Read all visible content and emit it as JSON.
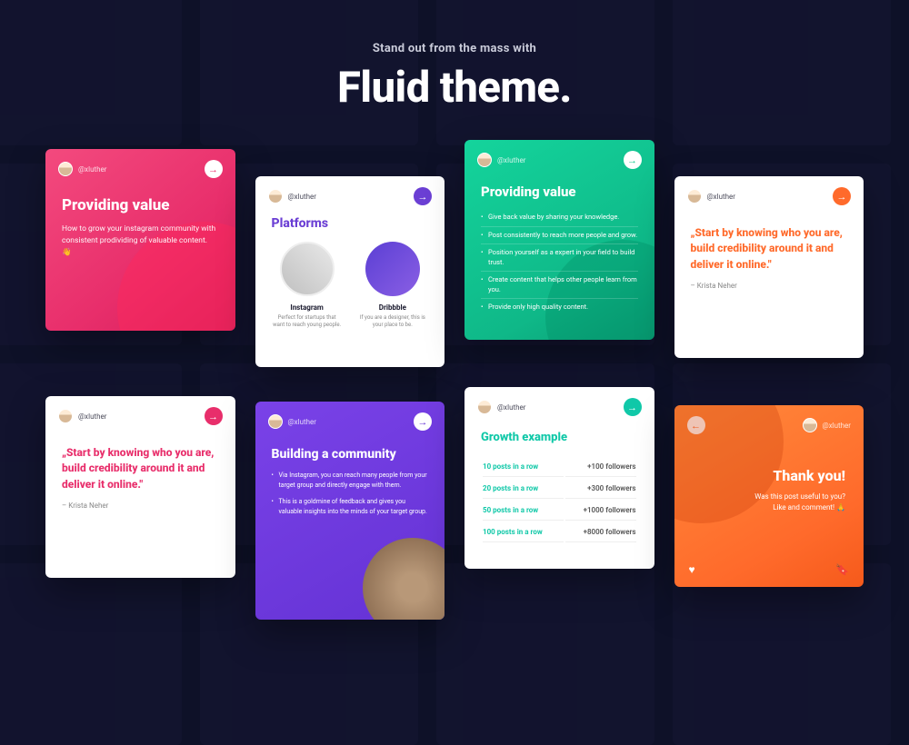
{
  "header": {
    "subtitle": "Stand out from the mass with",
    "title": "Fluid theme."
  },
  "handle": "@xluther",
  "cards": {
    "c1": {
      "title": "Providing value",
      "body": "How to grow your instagram community with consistent prodividing of valuable content. 👋"
    },
    "c2": {
      "title": "Platforms",
      "platforms": [
        {
          "name": "Instagram",
          "desc": "Perfect for startups that want to reach young people."
        },
        {
          "name": "Dribbble",
          "desc": "If you are a designer, this is your place to be."
        }
      ]
    },
    "c3": {
      "title": "Providing value",
      "items": [
        "Give back value by sharing your knowledge.",
        "Post consistently to reach more people and grow.",
        "Position yourself as a expert in your field to build trust.",
        "Create content that helps other people learn from you.",
        "Provide only high quality content."
      ]
    },
    "c4": {
      "quote": "„Start by knowing who you are, build credibility around it and deliver it online.\"",
      "author": "– Krista Neher"
    },
    "c5": {
      "quote": "„Start by knowing who you are, build credibility around it and deliver it online.\"",
      "author": "– Krista Neher"
    },
    "c6": {
      "title": "Building a community",
      "items": [
        "Via Instagram, you can reach many people from your target group and directly engage with them.",
        "This is a goldmine of feedback and gives you valuable insights into the minds of your target group."
      ]
    },
    "c7": {
      "title": "Growth example",
      "rows": [
        {
          "left": "10 posts in a row",
          "right": "+100 followers"
        },
        {
          "left": "20 posts in a row",
          "right": "+300 followers"
        },
        {
          "left": "50 posts in a row",
          "right": "+1000 followers"
        },
        {
          "left": "100 posts in a row",
          "right": "+8000 followers"
        }
      ]
    },
    "c8": {
      "title": "Thank you!",
      "body1": "Was this post useful to you?",
      "body2": "Like and comment! 🙏"
    }
  }
}
